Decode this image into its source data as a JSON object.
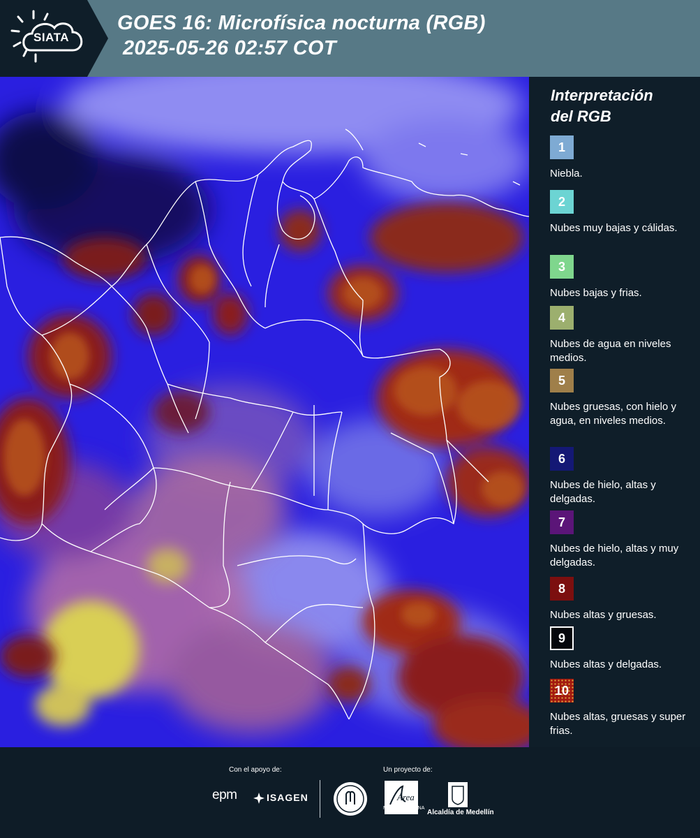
{
  "header": {
    "logo_text": "SIATA",
    "title_line1": "GOES 16: Microfísica nocturna (RGB)",
    "title_line2": "2025-05-26 02:57 COT",
    "background": "#577986",
    "logo_background": "#0f1e29"
  },
  "legend": {
    "title_line1": "Interpretación",
    "title_line2": "del RGB",
    "items": [
      {
        "number": "1",
        "label": "Niebla.",
        "color": "#7eaad3"
      },
      {
        "number": "2",
        "label": "Nubes muy bajas y cálidas.",
        "color": "#6cd4d3"
      },
      {
        "number": "3",
        "label": "Nubes bajas y frias.",
        "color": "#7fd68d"
      },
      {
        "number": "4",
        "label": "Nubes de agua en niveles medios.",
        "color": "#9caf6e"
      },
      {
        "number": "5",
        "label": "Nubes gruesas, con hielo y agua, en niveles medios.",
        "color": "#9f7f4a"
      },
      {
        "number": "6",
        "label": "Nubes de hielo, altas y delgadas.",
        "color": "#141875"
      },
      {
        "number": "7",
        "label": "Nubes de hielo, altas y muy delgadas.",
        "color": "#5b1578"
      },
      {
        "number": "8",
        "label": "Nubes altas y gruesas.",
        "color": "#7c0f0f"
      },
      {
        "number": "9",
        "label": "Nubes altas y delgadas.",
        "color": "#05070c"
      },
      {
        "number": "10",
        "label": "Nubes altas, gruesas y super frias.",
        "color": "#a31a10"
      }
    ]
  },
  "footer": {
    "support_caption": "Con el apoyo de:",
    "project_caption": "Un proyecto de:",
    "sponsor_epm": "epm",
    "sponsor_isagen": "ISAGEN",
    "metro_area_name": "Área",
    "metro_area_sub": "METROPOLITANA",
    "alcaldia": "Alcaldía de Medellín"
  },
  "colors": {
    "legend_bg": "#0f1e29",
    "page_bg": "#0e1c27",
    "map_base": "#2a1fe0"
  }
}
